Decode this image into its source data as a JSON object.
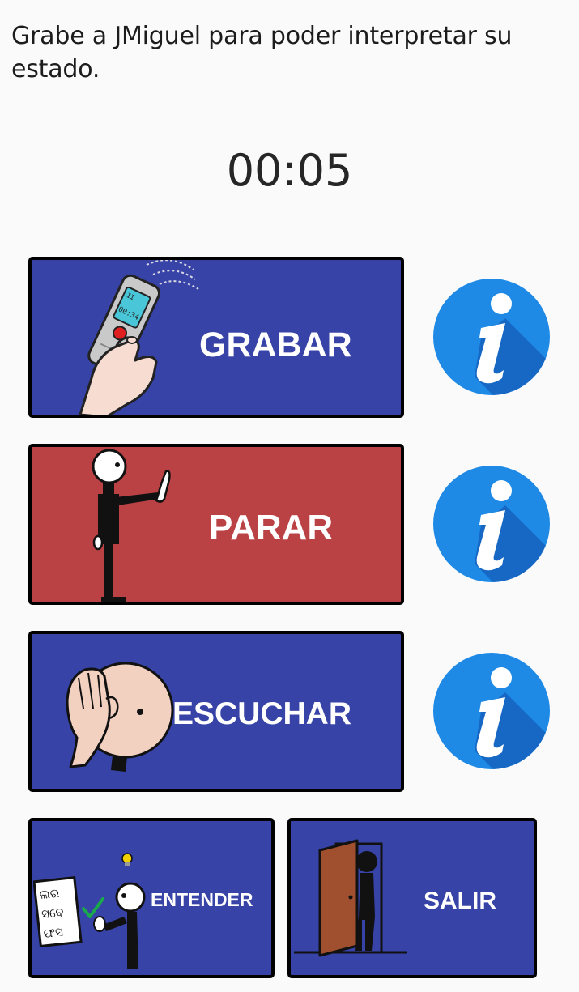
{
  "instruction": "Grabe a JMiguel para poder interpretar su estado.",
  "timer": "00:05",
  "buttons": {
    "record": {
      "label": "GRABAR",
      "icon": "voice-recorder-hand-icon",
      "color": "#3743a6"
    },
    "stop": {
      "label": "PARAR",
      "icon": "stop-gesture-person-icon",
      "color": "#bb4244"
    },
    "listen": {
      "label": "ESCUCHAR",
      "icon": "listening-head-icon",
      "color": "#3743a6"
    },
    "understand": {
      "label": "ENTENDER",
      "icon": "understanding-person-icon",
      "color": "#3743a6"
    },
    "exit": {
      "label": "SALIR",
      "icon": "exit-door-person-icon",
      "color": "#3743a6"
    }
  },
  "info_icon": {
    "icon": "info-icon",
    "color": "#1e8ae6"
  },
  "recorder_screen_text": "00:34"
}
